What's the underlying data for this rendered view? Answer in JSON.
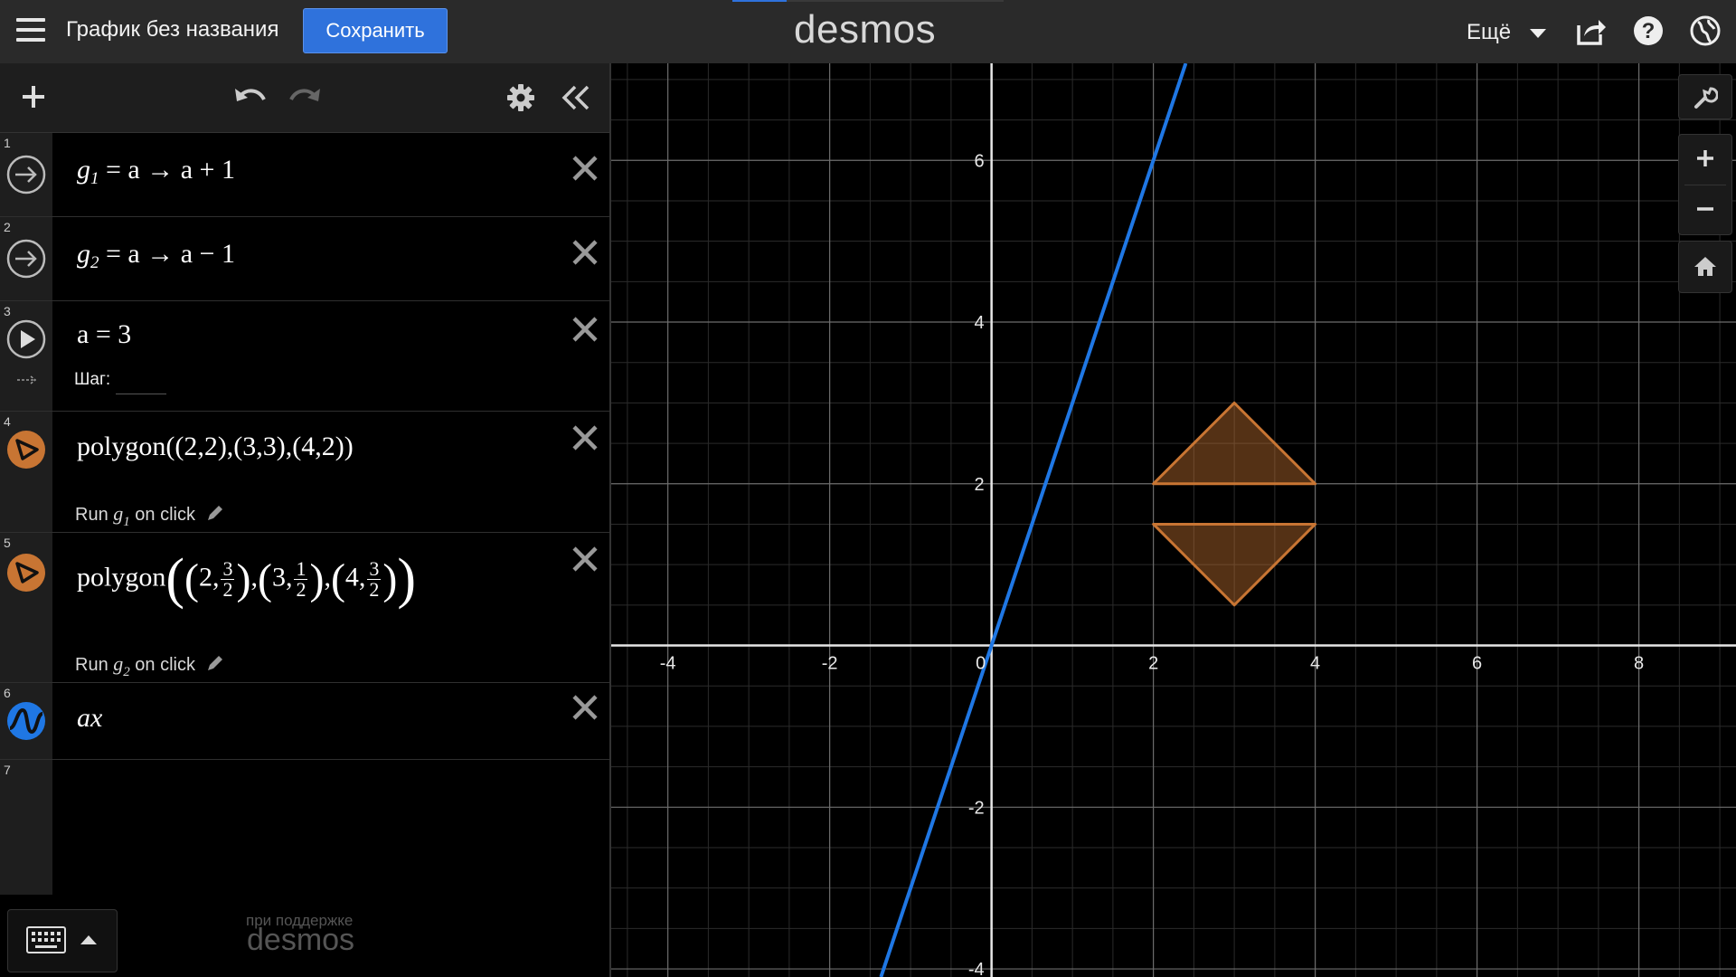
{
  "header": {
    "title": "График без названия",
    "save_label": "Сохранить",
    "brand": "desmos",
    "more_label": "Ещё",
    "icons": [
      "menu-icon",
      "share-icon",
      "help-icon",
      "globe-icon"
    ]
  },
  "toolbar": {
    "icons": [
      "add-icon",
      "undo-icon",
      "redo-icon",
      "gear-icon",
      "collapse-icon"
    ]
  },
  "expressions": [
    {
      "num": "1",
      "icon": "action-arrow-icon",
      "parts": {
        "var": "g",
        "sub": "1",
        "rest": " = a → a + 1"
      }
    },
    {
      "num": "2",
      "icon": "action-arrow-icon",
      "parts": {
        "var": "g",
        "sub": "2",
        "rest": " = a → a − 1"
      }
    },
    {
      "num": "3",
      "icon": "play-icon",
      "slider": {
        "latex": "a = 3",
        "step_label": "Шаг:"
      }
    },
    {
      "num": "4",
      "icon": "polygon-icon",
      "latex": "polygon((2,2),(3,3),(4,2))",
      "hint": {
        "pre": "Run ",
        "var": "g",
        "sub": "1",
        "post": " on click"
      }
    },
    {
      "num": "5",
      "icon": "polygon-icon",
      "hint": {
        "pre": "Run ",
        "var": "g",
        "sub": "2",
        "post": " on click"
      },
      "fracs": {
        "label": "polygon",
        "p1x": "2",
        "p1n": "3",
        "p1d": "2",
        "p2x": "3",
        "p2n": "1",
        "p2d": "2",
        "p3x": "4",
        "p3n": "3",
        "p3d": "2"
      }
    },
    {
      "num": "6",
      "icon": "wave-icon",
      "latex": "ax"
    },
    {
      "num": "7"
    }
  ],
  "footer": {
    "powered_by": "при поддержке",
    "powered_brand": "desmos"
  },
  "graph": {
    "x_ticks": [
      "-4",
      "-2",
      "0",
      "2",
      "4",
      "6",
      "8"
    ],
    "y_ticks": [
      "6",
      "4",
      "2",
      "-2",
      "-4"
    ],
    "xmin": -4.7,
    "xmax": 9.2,
    "ymin": -4.1,
    "ymax": 7.2,
    "line_slope": 3,
    "polygons": [
      {
        "points": [
          [
            2,
            2
          ],
          [
            3,
            3
          ],
          [
            4,
            2
          ]
        ],
        "color": "#c87533"
      },
      {
        "points": [
          [
            2,
            1.5
          ],
          [
            3,
            0.5
          ],
          [
            4,
            1.5
          ]
        ],
        "color": "#c87533"
      }
    ],
    "line_color": "#1f77e4",
    "controls": [
      "wrench-icon",
      "zoom-in-icon",
      "zoom-out-icon",
      "home-icon"
    ]
  }
}
